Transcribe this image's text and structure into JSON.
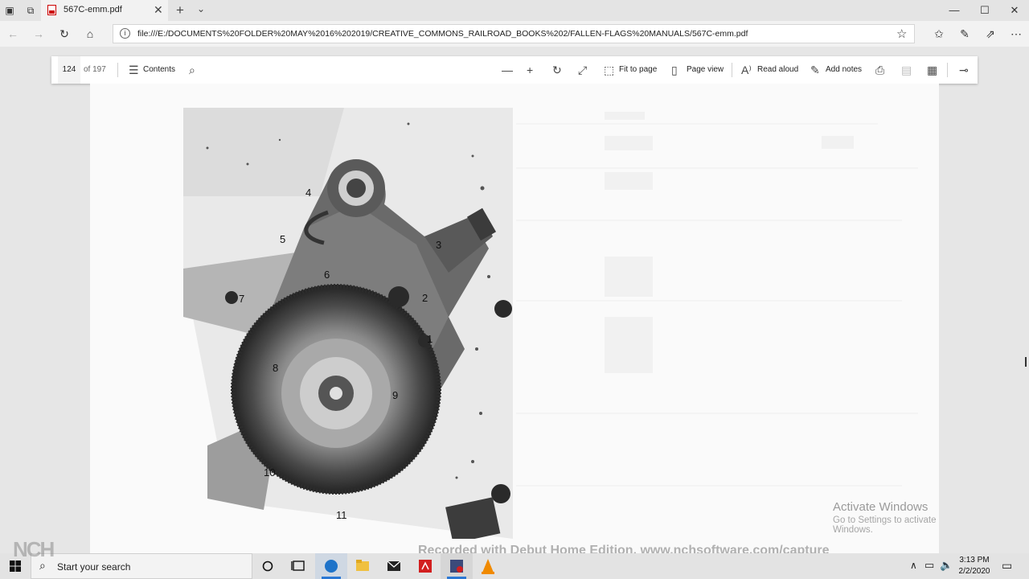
{
  "browser": {
    "tab": {
      "title": "567C-emm.pdf",
      "close_glyph": "✕"
    },
    "new_tab_glyph": "+",
    "tab_menu_glyph": "⌄",
    "window": {
      "minimize": "—",
      "maximize": "☐",
      "close": "✕"
    },
    "url": "file:///E:/DOCUMENTS%20FOLDER%20MAY%2016%202019/CREATIVE_COMMONS_RAILROAD_BOOKS%202/FALLEN-FLAGS%20MANUALS/567C-emm.pdf"
  },
  "pdf_toolbar": {
    "page_number": "124",
    "page_total": "of 197",
    "contents_label": "Contents",
    "fit_label": "Fit to page",
    "page_view_label": "Page view",
    "read_aloud_label": "Read aloud",
    "add_notes_label": "Add notes"
  },
  "figure": {
    "callouts": [
      "4",
      "5",
      "3",
      "6",
      "2",
      "7",
      "1",
      "8",
      "9",
      "10",
      "11"
    ]
  },
  "overlay": {
    "activate_title": "Activate Windows",
    "activate_sub": "Go to Settings to activate Windows.",
    "recorded": "Recorded with Debut Home Edition. www.nchsoftware.com/capture",
    "nch_logo": "NCH"
  },
  "taskbar": {
    "search_placeholder": "Start your search",
    "time": "3:13 PM",
    "date": "2/2/2020"
  },
  "icons": [
    "windows-logo-icon",
    "task-view-icon",
    "pdf-file-icon",
    "back-icon",
    "forward-icon",
    "refresh-icon",
    "home-icon",
    "info-icon",
    "star-icon",
    "favorites-icon",
    "pen-icon",
    "share-icon",
    "more-icon",
    "menu-list-icon",
    "search-icon",
    "zoom-out-icon",
    "zoom-in-icon",
    "rotate-icon",
    "fullscreen-icon",
    "fit-icon",
    "page-view-icon",
    "read-aloud-icon",
    "add-notes-icon",
    "print-icon",
    "save-icon",
    "save-as-icon",
    "pin-icon",
    "cortana-icon",
    "edge-icon",
    "explorer-icon",
    "mail-icon",
    "acrobat-icon",
    "app-icon",
    "vlc-icon",
    "tray-chevron-icon",
    "network-icon",
    "volume-icon",
    "notification-icon"
  ]
}
